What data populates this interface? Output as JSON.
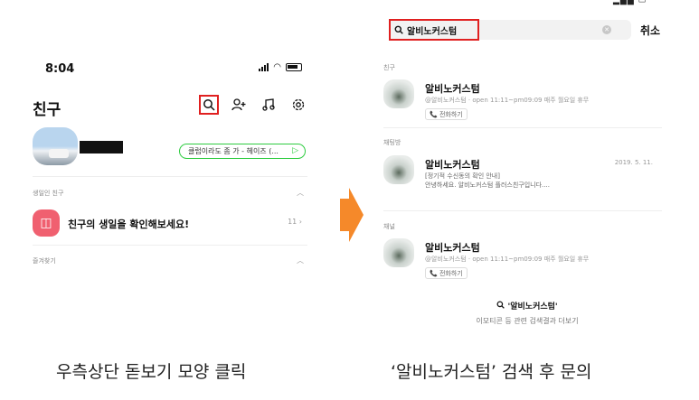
{
  "left_screen": {
    "time": "8:04",
    "title": "친구",
    "header_icons": [
      "search-icon",
      "add-friend-icon",
      "music-icon",
      "settings-icon"
    ],
    "status_message": "클럽이라도 좀 가 - 헤이즈 (...",
    "birthday_section": "생일인 친구",
    "birthday_text": "친구의 생일을 확인해보세요!",
    "birthday_count": "11",
    "favorites_section": "즐겨찾기"
  },
  "left_caption": "우측상단 돋보기 모양 클릭",
  "right_screen": {
    "search_value": "알비노커스텀",
    "cancel_label": "취소",
    "friends_section": "친구",
    "chats_section": "채팅방",
    "channel_section": "채널",
    "friend_result": {
      "name": "알비노커스텀",
      "sub": "@알비노커스텀 · open 11:11~pm09:09 매주 월요일 휴무",
      "call": "📞 전화하기"
    },
    "chat_result": {
      "name": "알비노커스텀",
      "line1": "[정기적 수신동의 확인 안내]",
      "line2": "안녕하세요. 알비노커스텀 플러스친구입니다....",
      "date": "2019. 5. 11."
    },
    "channel_result": {
      "name": "알비노커스텀",
      "sub": "@알비노커스텀 · open 11:11~pm09:09 매주 월요일 휴무",
      "call": "📞 전화하기"
    },
    "more_title": "'알비노커스텀'",
    "more_sub": "이모티콘 등 관련 검색결과 더보기"
  },
  "right_caption": "‘알비노커스텀’ 검색 후 문의",
  "colors": {
    "highlight": "#e02020",
    "arrow": "#f5892a",
    "status_green": "#2ecc40",
    "birthday_red": "#f06070"
  }
}
